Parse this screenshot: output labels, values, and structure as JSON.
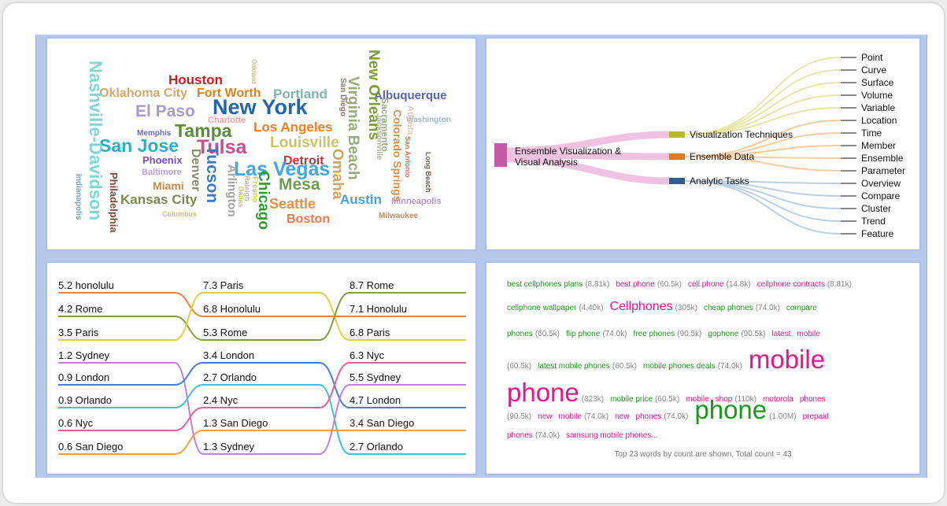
{
  "cloud": {
    "words": [
      {
        "t": "Houston",
        "c": "#d7191c",
        "s": 17
      },
      {
        "t": "Oklahoma City",
        "c": "#d9a66a",
        "s": 16
      },
      {
        "t": "Fort Worth",
        "c": "#e08214",
        "s": 16
      },
      {
        "t": "Portland",
        "c": "#7fb6a8",
        "s": 17
      },
      {
        "t": "Albuquerque",
        "c": "#5a63b8",
        "s": 15
      },
      {
        "t": "El Paso",
        "c": "#a89ad8",
        "s": 21
      },
      {
        "t": "New York",
        "c": "#2166ac",
        "s": 27
      },
      {
        "t": "Charlotte",
        "c": "#f4a0a0",
        "s": 11
      },
      {
        "t": "Los Angeles",
        "c": "#f07f22",
        "s": 17
      },
      {
        "t": "Washington",
        "c": "#9db9d8",
        "s": 10
      },
      {
        "t": "Memphis",
        "c": "#6a6ab8",
        "s": 10
      },
      {
        "t": "Tampa",
        "c": "#5a8c3a",
        "s": 23
      },
      {
        "t": "San Jose",
        "c": "#22b2c7",
        "s": 23
      },
      {
        "t": "Tulsa",
        "c": "#c6508e",
        "s": 25
      },
      {
        "t": "Louisville",
        "c": "#c9c36a",
        "s": 19
      },
      {
        "t": "Phoenix",
        "c": "#7a4fb5",
        "s": 13
      },
      {
        "t": "Detroit",
        "c": "#c0353a",
        "s": 16
      },
      {
        "t": "Baltimore",
        "c": "#b3a0d8",
        "s": 11
      },
      {
        "t": "Las Vegas",
        "c": "#3fa7e8",
        "s": 25
      },
      {
        "t": "Miami",
        "c": "#c58a4c",
        "s": 14
      },
      {
        "t": "Mesa",
        "c": "#6e9e50",
        "s": 21
      },
      {
        "t": "Kansas City",
        "c": "#7b8a4e",
        "s": 17
      },
      {
        "t": "Seattle",
        "c": "#f58e3c",
        "s": 18
      },
      {
        "t": "Austin",
        "c": "#4f9fe0",
        "s": 17
      },
      {
        "t": "Minneapolis",
        "c": "#b39ad0",
        "s": 11
      },
      {
        "t": "Columbus",
        "c": "#d7c26b",
        "s": 9
      },
      {
        "t": "Boston",
        "c": "#ee7a4e",
        "s": 16
      },
      {
        "t": "Milwaukee",
        "c": "#c08a64",
        "s": 10
      },
      {
        "t": "Nashville-Davidson",
        "c": "#7fd6d2",
        "s": 22
      },
      {
        "t": "Indianapolis",
        "c": "#6ea0d0",
        "s": 10
      },
      {
        "t": "Philadelphia",
        "c": "#7b4a3e",
        "s": 13
      },
      {
        "t": "Denver",
        "c": "#8a8c70",
        "s": 16
      },
      {
        "t": "Tucson",
        "c": "#3b79c2",
        "s": 21
      },
      {
        "t": "Arlington",
        "c": "#a3a3a3",
        "s": 15
      },
      {
        "t": "Fresno",
        "c": "#d4c95a",
        "s": 10
      },
      {
        "t": "Raleigh",
        "c": "#c8b89a",
        "s": 9
      },
      {
        "t": "Dallas",
        "c": "#d0c070",
        "s": 9
      },
      {
        "t": "Chicago",
        "c": "#2a9d2a",
        "s": 19
      },
      {
        "t": "Oakland",
        "c": "#c4c27a",
        "s": 8
      },
      {
        "t": "San Diego",
        "c": "#8a7a6a",
        "s": 10
      },
      {
        "t": "Virginia Beach",
        "c": "#9aaa7a",
        "s": 19
      },
      {
        "t": "New Orleans",
        "c": "#7b9a3a",
        "s": 19
      },
      {
        "t": "Omaha",
        "c": "#c8a860",
        "s": 19
      },
      {
        "t": "Sacramento",
        "c": "#9aaa8a",
        "s": 12
      },
      {
        "t": "Jacksonville",
        "c": "#b0b090",
        "s": 10
      },
      {
        "t": "Colorado Springs",
        "c": "#d89050",
        "s": 14
      },
      {
        "t": "Atlanta",
        "c": "#e0c8b0",
        "s": 11
      },
      {
        "t": "San Antonio",
        "c": "#e07050",
        "s": 9
      },
      {
        "t": "Long Beach",
        "c": "#706050",
        "s": 9
      }
    ]
  },
  "tree": {
    "root": "Ensemble Visualization & Visual Analysis",
    "groups": [
      {
        "label": "Visualization Techniques",
        "color": "#b6b825",
        "leaves": [
          "Point",
          "Curve",
          "Surface",
          "Volume",
          "Variable"
        ]
      },
      {
        "label": "Ensemble Data",
        "color": "#e07a20",
        "leaves": [
          "Location",
          "Time",
          "Member",
          "Ensemble",
          "Parameter"
        ]
      },
      {
        "label": "Analytic Tasks",
        "color": "#2f5f8f",
        "leaves": [
          "Overview",
          "Compare",
          "Cluster",
          "Trend",
          "Feature"
        ]
      }
    ]
  },
  "bump": {
    "columns": [
      [
        "5.2 honolulu",
        "4.2 Rome",
        "3.5 Paris",
        "1.2 Sydney",
        "0.9 London",
        "0.9 Orlando",
        "0.6 Nyc",
        "0.6 San Diego"
      ],
      [
        "7.3 Paris",
        "6.8 Honolulu",
        "5.3 Rome",
        "3.4 London",
        "2.7 Orlando",
        "2.4 Nyc",
        "1.3 San Diego",
        "1.3 Sydney"
      ],
      [
        "8.7 Rome",
        "7.1 Honolulu",
        "6.8 Paris",
        "6.3 Nyc",
        "5.5 Sydney",
        "4.7 London",
        "3.4 San Diego",
        "2.7 Orlando"
      ]
    ],
    "colors": {
      "Honolulu": "#f08040",
      "Rome": "#80a040",
      "Paris": "#e0d040",
      "Sydney": "#c080e0",
      "London": "#4080e0",
      "Orlando": "#40c0e0",
      "Nyc": "#e060a0",
      "San Diego": "#f0a040"
    }
  },
  "words": {
    "colors": {
      "g": "#1a9a1a",
      "p": "#e8148c"
    },
    "lines": [
      [
        {
          "t": "best cellphones plans",
          "c": "(8.81k)",
          "k": "g",
          "s": 10
        },
        {
          "t": "best phone",
          "c": "(60.5k)",
          "k": "p",
          "s": 10
        },
        {
          "t": "cell phone",
          "c": "(14.8k)",
          "k": "p",
          "s": 10
        },
        {
          "t": "cellphone contracts",
          "c": "(8.81k)",
          "k": "p",
          "s": 10
        }
      ],
      [
        {
          "t": "cellphone wallpaper",
          "c": "(4.40k)",
          "k": "g",
          "s": 10
        },
        {
          "t": "Cellphones",
          "c": "(305k)",
          "k": "p",
          "s": 16
        },
        {
          "t": "cheap phones",
          "c": "(74.0k)",
          "k": "g",
          "s": 10
        },
        {
          "t": "compare",
          "c": "",
          "k": "g",
          "s": 10
        }
      ],
      [
        {
          "t": "phones",
          "c": "(60.5k)",
          "k": "g",
          "s": 10
        },
        {
          "t": "flip phone",
          "c": "(74.0k)",
          "k": "g",
          "s": 10
        },
        {
          "t": "free phones",
          "c": "(90.5k)",
          "k": "g",
          "s": 10
        },
        {
          "t": "gophone",
          "c": "(90.5k)",
          "k": "g",
          "s": 10
        },
        {
          "t": "latest",
          "c": "",
          "k": "p",
          "s": 10
        },
        {
          "t": "mobile",
          "c": "",
          "k": "p",
          "s": 10
        }
      ],
      [
        {
          "t": "",
          "c": "(60.5k)",
          "k": "p",
          "s": 10
        },
        {
          "t": "latest mobile phones",
          "c": "(60.5k)",
          "k": "g",
          "s": 10
        },
        {
          "t": "mobile phones deals",
          "c": "(74.0k)",
          "k": "g",
          "s": 10
        },
        {
          "t": "mobile",
          "c": "",
          "k": "p",
          "s": 33
        }
      ],
      [
        {
          "t": "phone",
          "c": "(823k)",
          "k": "p",
          "s": 33
        },
        {
          "t": "mobile price",
          "c": "(60.5k)",
          "k": "g",
          "s": 10
        },
        {
          "t": "mobile",
          "c": "",
          "k": "p",
          "s": 10
        },
        {
          "t": "shop",
          "c": "(110k)",
          "k": "p",
          "s": 10
        },
        {
          "t": "motorola",
          "c": "",
          "k": "p",
          "s": 10
        },
        {
          "t": "phones",
          "c": "",
          "k": "p",
          "s": 10
        }
      ],
      [
        {
          "t": "",
          "c": "(90.5k)",
          "k": "p",
          "s": 10
        },
        {
          "t": "new",
          "c": "",
          "k": "p",
          "s": 10
        },
        {
          "t": "mobile",
          "c": "(74.0k)",
          "k": "p",
          "s": 10
        },
        {
          "t": "new",
          "c": "",
          "k": "p",
          "s": 10
        },
        {
          "t": "phones",
          "c": "(74.0k)",
          "k": "p",
          "s": 10
        },
        {
          "t": "phone",
          "c": "(1.00M)",
          "k": "g",
          "s": 33
        },
        {
          "t": "prepaid",
          "c": "",
          "k": "p",
          "s": 10
        }
      ],
      [
        {
          "t": "phones",
          "c": "(74.0k)",
          "k": "p",
          "s": 10
        },
        {
          "t": "samsung mobile phones...",
          "c": "",
          "k": "p",
          "s": 10
        }
      ]
    ],
    "footer": "Top 23 words by count are shown, Total count = 43"
  }
}
